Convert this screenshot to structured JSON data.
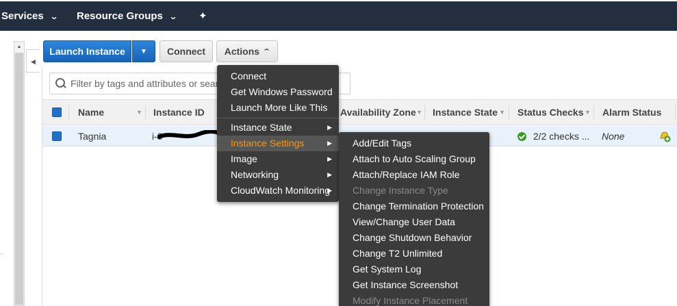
{
  "topnav": {
    "services_label": "Services",
    "resource_groups_label": "Resource Groups"
  },
  "toolbar": {
    "launch_label": "Launch Instance",
    "connect_label": "Connect",
    "actions_label": "Actions"
  },
  "search": {
    "placeholder": "Filter by tags and attributes or search"
  },
  "table": {
    "columns": {
      "name": "Name",
      "instance_id": "Instance ID",
      "availability_zone": "Availability Zone",
      "instance_state": "Instance State",
      "status_checks": "Status Checks",
      "alarm_status": "Alarm Status"
    },
    "rows": [
      {
        "name": "Tagnia",
        "instance_id": "i-0",
        "status_checks": "2/2 checks ...",
        "alarm_status": "None"
      }
    ]
  },
  "actions_menu": {
    "items": [
      "Connect",
      "Get Windows Password",
      "Launch More Like This",
      "Instance State",
      "Instance Settings",
      "Image",
      "Networking",
      "CloudWatch Monitoring"
    ],
    "active_item": "Instance Settings"
  },
  "settings_submenu": {
    "items": [
      "Add/Edit Tags",
      "Attach to Auto Scaling Group",
      "Attach/Replace IAM Role",
      "Change Instance Type",
      "Change Termination Protection",
      "View/Change User Data",
      "Change Shutdown Behavior",
      "Change T2 Unlimited",
      "Get System Log",
      "Get Instance Screenshot",
      "Modify Instance Placement"
    ],
    "disabled_items": [
      "Change Instance Type",
      "Modify Instance Placement"
    ]
  },
  "colors": {
    "nav_bg": "#232f3e",
    "primary": "#1a73c9",
    "menu_bg": "#3b3b3b",
    "menu_highlight": "#ff9900",
    "status_ok": "#3c9b28"
  },
  "icons": [
    "chevron-down-icon",
    "pin-icon",
    "caret-down-icon",
    "caret-up-icon",
    "search-icon",
    "sort-caret-icon",
    "check-circle-icon",
    "alarm-add-icon",
    "chevron-right-icon",
    "scroll-up-icon",
    "collapse-left-icon"
  ]
}
